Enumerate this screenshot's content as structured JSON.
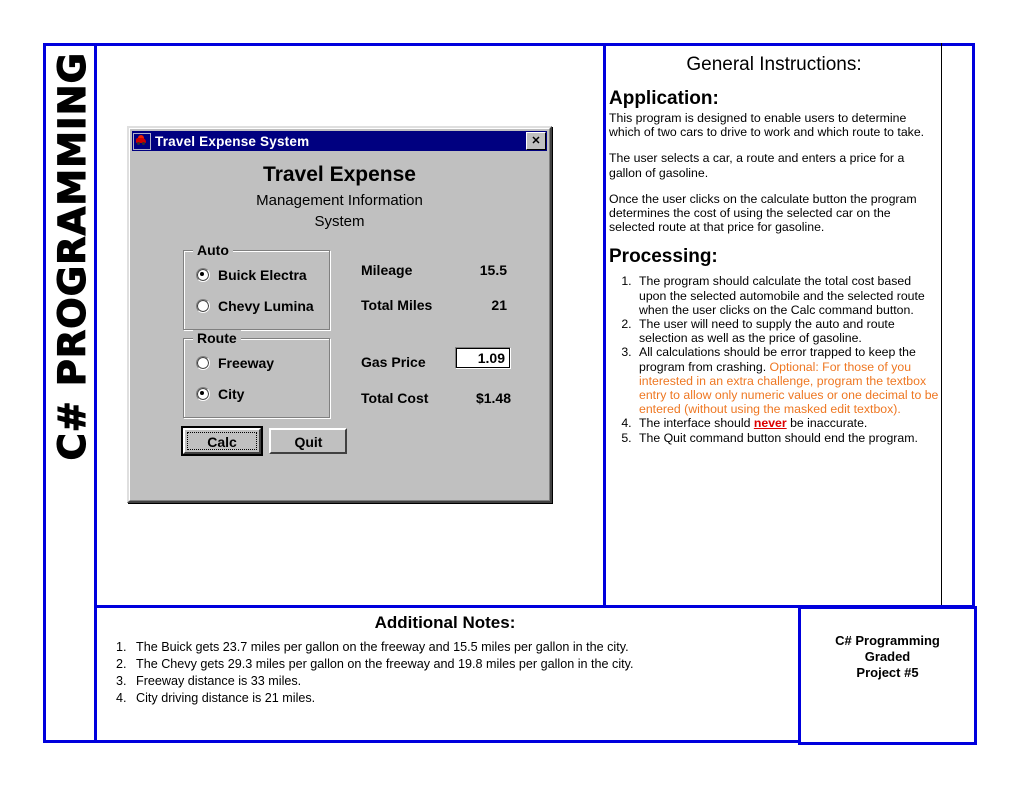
{
  "spine": {
    "label": "C# PROGRAMMING"
  },
  "dialog": {
    "title": "Travel Expense System",
    "icon": "car-icon",
    "close_label": "✕",
    "heading": "Travel Expense",
    "subheading": "Management Information\nSystem",
    "subheading_line1": "Management Information",
    "subheading_line2": "System",
    "auto_group": {
      "label": "Auto",
      "options": [
        {
          "label": "Buick Electra",
          "checked": true
        },
        {
          "label": "Chevy Lumina",
          "checked": false
        }
      ]
    },
    "route_group": {
      "label": "Route",
      "options": [
        {
          "label": "Freeway",
          "checked": false
        },
        {
          "label": "City",
          "checked": true
        }
      ]
    },
    "fields": [
      {
        "label": "Mileage",
        "value": "15.5"
      },
      {
        "label": "Total Miles",
        "value": "21"
      },
      {
        "label": "Gas Price",
        "value": "1.09"
      },
      {
        "label": "Total Cost",
        "value": "$1.48"
      }
    ],
    "buttons": [
      {
        "label": "Calc",
        "default": true
      },
      {
        "label": "Quit",
        "default": false
      }
    ]
  },
  "instructions": {
    "title": "General Instructions:",
    "application_heading": "Application:",
    "application_paragraphs": [
      "This program is designed to enable users to determine which of two cars to drive to work and which route to take.",
      "The user selects a car, a route and enters a price for a gallon of gasoline.",
      "Once the user clicks on the calculate button the program determines the cost of using the selected car on the selected route at that price for gasoline."
    ],
    "processing_heading": "Processing:",
    "processing_items": {
      "item1": "The program should calculate the total cost based upon the selected automobile and the selected route when the user clicks on the Calc command button.",
      "item2": "The user will need to supply the auto and route selection as well as the price of gasoline.",
      "item3_black": "All calculations should be error trapped to keep the program from crashing.",
      "item3_orange": "Optional: For those of you interested in an extra challenge, program  the textbox entry to allow only numeric values or one decimal to be entered (without using the masked edit textbox).",
      "item4_pre": "The interface should ",
      "item4_emph": "never",
      "item4_post": " be inaccurate.",
      "item5": "The Quit command button should end the program."
    }
  },
  "notes": {
    "title": "Additional Notes:",
    "items": [
      "The Buick gets 23.7 miles per gallon on the freeway and 15.5 miles per gallon in the city.",
      "The Chevy gets 29.3 miles per gallon on the freeway and 19.8 miles per gallon in the city.",
      "Freeway distance is 33 miles.",
      "City driving distance is 21 miles."
    ]
  },
  "project": {
    "line1": "C# Programming",
    "line2": "Graded",
    "line3": "Project #5"
  },
  "colors": {
    "frame_blue": "#0000dd",
    "optional_orange": "#ee7722",
    "never_red": "#dd0000",
    "titlebar_blue": "#000080",
    "dialog_gray": "#c0c0c0"
  }
}
